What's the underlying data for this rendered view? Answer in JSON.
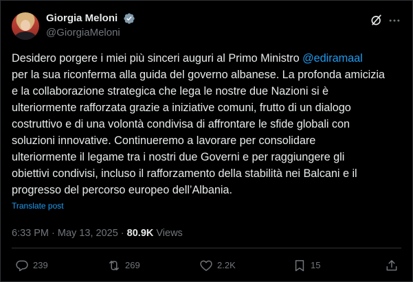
{
  "author": {
    "display_name": "Giorgia Meloni",
    "handle": "@GiorgiaMeloni",
    "verified_icon": "verified-badge-icon"
  },
  "header_actions": {
    "grok_icon": "grok-slash-circle-icon",
    "more_icon": "more-options-icon"
  },
  "tweet": {
    "text_before_mention": "Desidero porgere i miei più sinceri auguri al Primo Ministro ",
    "mention": "@ediramaal",
    "text_after_mention": "\nper la sua riconferma alla guida del governo albanese. La profonda amicizia\ne la collaborazione strategica che lega le nostre due Nazioni si è\nulteriormente rafforzata grazie a iniziative comuni, frutto di un dialogo\ncostruttivo e di una volontà condivisa di affrontare le sfide globali con\nsoluzioni innovative. Continueremo a lavorare per consolidare\nulteriormente il legame tra i nostri due Governi e per raggiungere gli\nobiettivi condivisi, incluso il rafforzamento della stabilità nei Balcani e il\nprogresso del percorso europeo dell’Albania.",
    "translate_label": "Translate post"
  },
  "meta": {
    "time": "6:33 PM",
    "separator": " · ",
    "date": "May 13, 2025",
    "separator2": " · ",
    "views_count": "80.9K",
    "views_label": " Views"
  },
  "actions": {
    "replies": "239",
    "reposts": "269",
    "likes": "2.2K",
    "bookmarks": "15"
  },
  "colors": {
    "background": "#000000",
    "text": "#e7e9ea",
    "secondary": "#71767b",
    "link": "#1d9bf0",
    "border": "#2f3336"
  }
}
